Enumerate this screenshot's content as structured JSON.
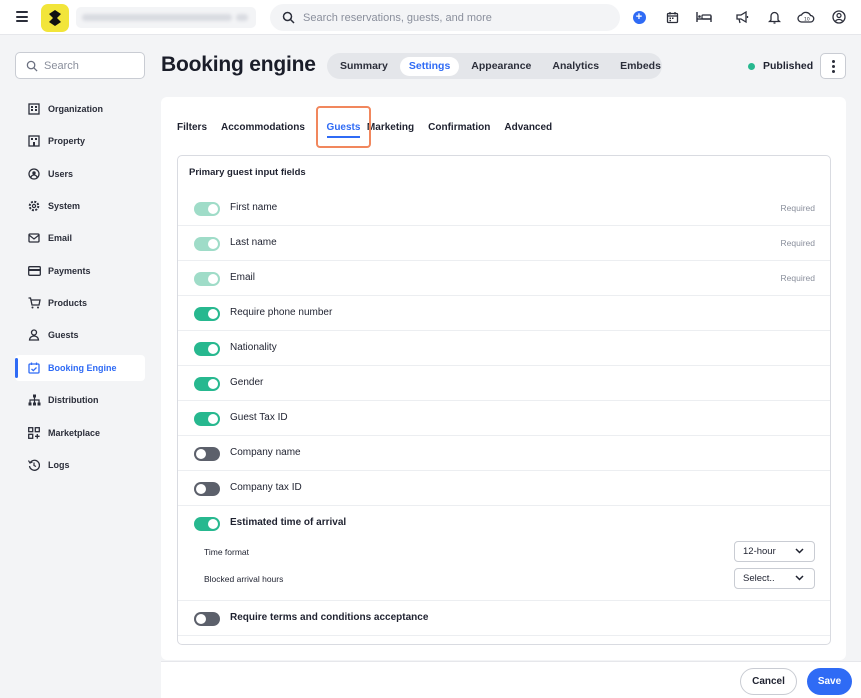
{
  "topbar": {
    "search_placeholder": "Search reservations, guests, and more",
    "icons": [
      "menu-icon",
      "add-icon",
      "calendar-icon",
      "bed-icon",
      "megaphone-icon",
      "bell-icon",
      "cloud-icon",
      "account-icon"
    ]
  },
  "sidebar": {
    "search_placeholder": "Search",
    "items": [
      {
        "label": "Organization",
        "icon": "building-icon"
      },
      {
        "label": "Property",
        "icon": "property-icon"
      },
      {
        "label": "Users",
        "icon": "users-icon"
      },
      {
        "label": "System",
        "icon": "gear-icon"
      },
      {
        "label": "Email",
        "icon": "email-icon"
      },
      {
        "label": "Payments",
        "icon": "card-icon"
      },
      {
        "label": "Products",
        "icon": "cart-icon"
      },
      {
        "label": "Guests",
        "icon": "guest-icon"
      },
      {
        "label": "Booking Engine",
        "icon": "booking-icon",
        "active": true
      },
      {
        "label": "Distribution",
        "icon": "distribution-icon"
      },
      {
        "label": "Marketplace",
        "icon": "marketplace-icon"
      },
      {
        "label": "Logs",
        "icon": "history-icon"
      }
    ]
  },
  "header": {
    "title": "Booking engine",
    "tabs": [
      "Summary",
      "Settings",
      "Appearance",
      "Analytics",
      "Embeds"
    ],
    "active_tab": "Settings",
    "status": "Published"
  },
  "subtabs": [
    "Filters",
    "Accommodations",
    "Guests",
    "Marketing",
    "Confirmation",
    "Advanced"
  ],
  "section": {
    "title": "Primary guest input fields",
    "required_label": "Required",
    "fields": [
      {
        "label": "First name",
        "state": "locked",
        "required": true
      },
      {
        "label": "Last name",
        "state": "locked",
        "required": true
      },
      {
        "label": "Email",
        "state": "locked",
        "required": true
      },
      {
        "label": "Require phone number",
        "state": "on"
      },
      {
        "label": "Nationality",
        "state": "on"
      },
      {
        "label": "Gender",
        "state": "on"
      },
      {
        "label": "Guest Tax ID",
        "state": "on"
      },
      {
        "label": "Company name",
        "state": "off"
      },
      {
        "label": "Company tax ID",
        "state": "off"
      },
      {
        "label": "Estimated time of arrival",
        "state": "on"
      }
    ],
    "eta": {
      "time_format_label": "Time format",
      "time_format_value": "12-hour",
      "blocked_label": "Blocked arrival hours",
      "blocked_value": "Select.."
    },
    "terms": {
      "label": "Require terms and conditions acceptance",
      "state": "off"
    }
  },
  "footer": {
    "cancel": "Cancel",
    "save": "Save"
  },
  "colors": {
    "accent": "#2f6bf5",
    "toggle_on": "#27b88f",
    "highlight": "#f1875d",
    "logo": "#f2e53a"
  }
}
